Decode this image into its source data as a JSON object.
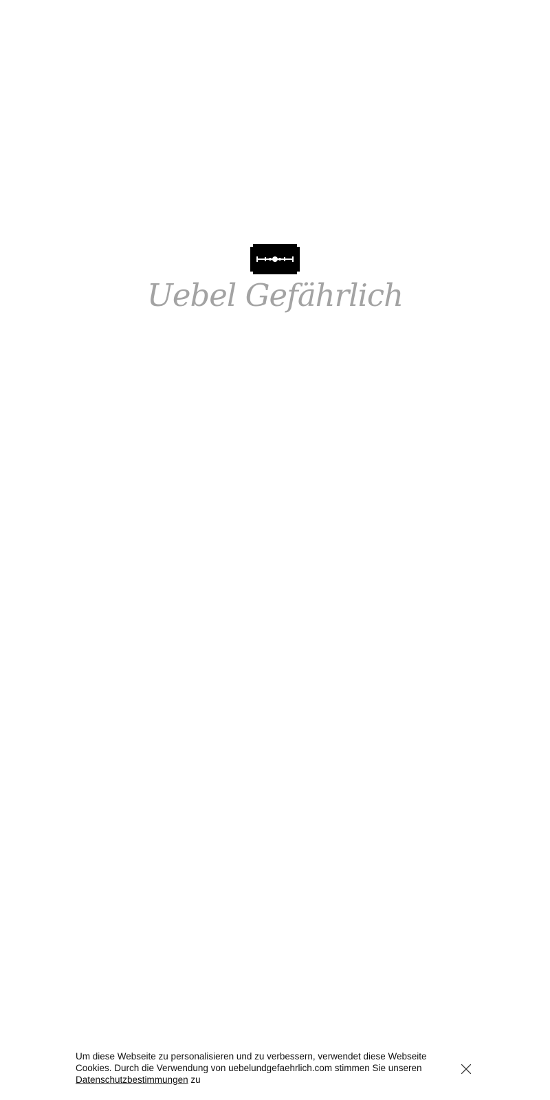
{
  "logo": {
    "icon": "razor-blade-icon",
    "wordmark": "Uebel Gefährlich",
    "wordmark_color": "#a3a3a3"
  },
  "cookie_banner": {
    "text_before_link": "Um diese Webseite zu personalisieren und zu verbessern, verwendet diese Webseite Cookies. Durch die Verwendung von uebelundgefaehrlich.com stimmen Sie unseren ",
    "link_label": "Datenschutzbestimmungen",
    "text_after_link": " zu",
    "close_icon": "close-icon"
  }
}
